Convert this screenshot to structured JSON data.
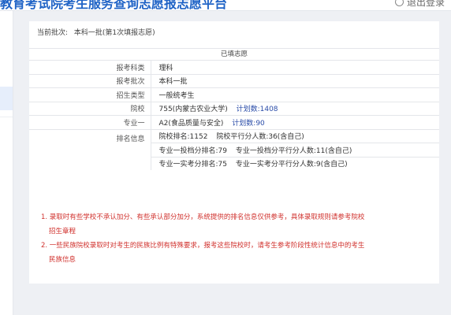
{
  "header": {
    "title": "教育考试院考生服务查询志愿报志愿平台",
    "user_label": "退出登录"
  },
  "batch": {
    "label": "当前批次:",
    "value": "本科一批(第1次填报志愿)"
  },
  "table": {
    "section_header": "已填志愿",
    "rows": {
      "subject": {
        "label": "报考科类",
        "value": "理科"
      },
      "batch": {
        "label": "报考批次",
        "value": "本科一批"
      },
      "type": {
        "label": "招生类型",
        "value": "一般统考生"
      },
      "school": {
        "label": "院校",
        "value": "755(内蒙古农业大学)",
        "plan": "计划数:1408"
      },
      "major": {
        "label": "专业一",
        "value": "A2(食品质量与安全)",
        "plan": "计划数:90"
      },
      "rank": {
        "label": "排名信息",
        "line1_a": "院校排名:1152",
        "line1_b": "院校平行分人数:36(含自己)",
        "line2_a": "专业一投档分排名:79",
        "line2_b": "专业一投档分平行分人数:11(含自己)",
        "line3_a": "专业一实考分排名:75",
        "line3_b": "专业一实考分平行分人数:9(含自己)"
      }
    }
  },
  "notes": [
    {
      "line1": "1. 录取时有些学校不承认加分、有些承认部分加分，系统提供的排名信息仅供参考，具体录取规则请参考院校",
      "line2": "招生章程"
    },
    {
      "line1": "2. 一些民族院校录取时对考生的民族比例有特殊要求，报考这些院校时，请考生参考阶段性统计信息中的考生",
      "line2": "民族信息"
    }
  ],
  "colors": {
    "accent": "#1f63c6",
    "link": "#2a4ca8",
    "warning": "#d0312d"
  }
}
